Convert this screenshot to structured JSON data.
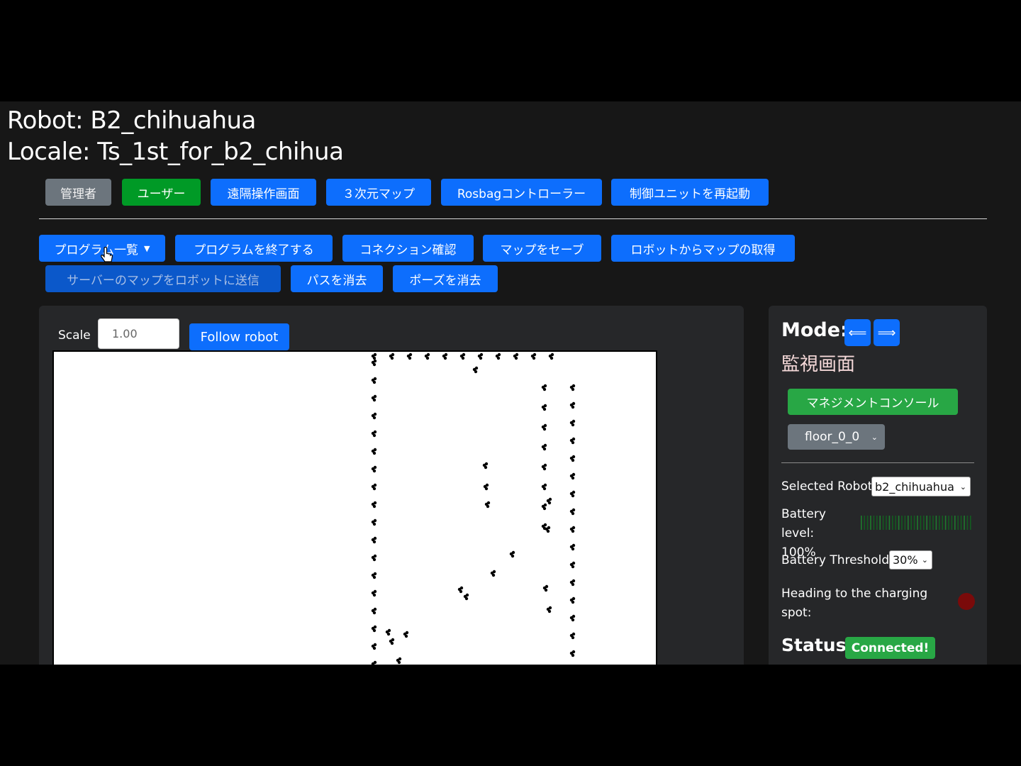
{
  "header": {
    "robot": "Robot: B2_chihuahua",
    "locale": "Locale: Ts_1st_for_b2_chihua"
  },
  "nav_buttons": {
    "admin": "管理者",
    "user": "ユーザー",
    "teleop": "遠隔操作画面",
    "map3d": "３次元マップ",
    "rosbag": "Rosbagコントローラー",
    "restart": "制御ユニットを再起動"
  },
  "action_buttons": {
    "programs": "プログラム一覧",
    "end_program": "プログラムを終了する",
    "connection_check": "コネクション確認",
    "save_map": "マップをセーブ",
    "get_map": "ロボットからマップの取得",
    "send_map": "サーバーのマップをロボットに送信",
    "clear_path": "パスを消去",
    "clear_pose": "ポーズを消去"
  },
  "map_panel": {
    "scale_label": "Scale",
    "scale_value": "1.00",
    "follow_label": "Follow robot"
  },
  "side_panel": {
    "mode_label": "Mode:",
    "mode_prev_icon": "⟸",
    "mode_next_icon": "⟹",
    "mode_name": "監視画面",
    "management_console": "マネジメントコンソール",
    "floor_value": "floor_0_0",
    "selected_robot_label": "Selected Robot",
    "selected_robot_value": "b2_chihuahua",
    "battery_label": "Battery level: 100%",
    "battery_level": 1.0,
    "battery_threshold_label": "Battery Threshold:",
    "battery_threshold_value": "30%",
    "charging_label": "Heading to the charging spot:",
    "status_label": "Status:",
    "status_value": "Connected!"
  },
  "colors": {
    "primary": "#0d6efd",
    "success": "#28a745",
    "indicator_off": "#7a0a0a"
  }
}
